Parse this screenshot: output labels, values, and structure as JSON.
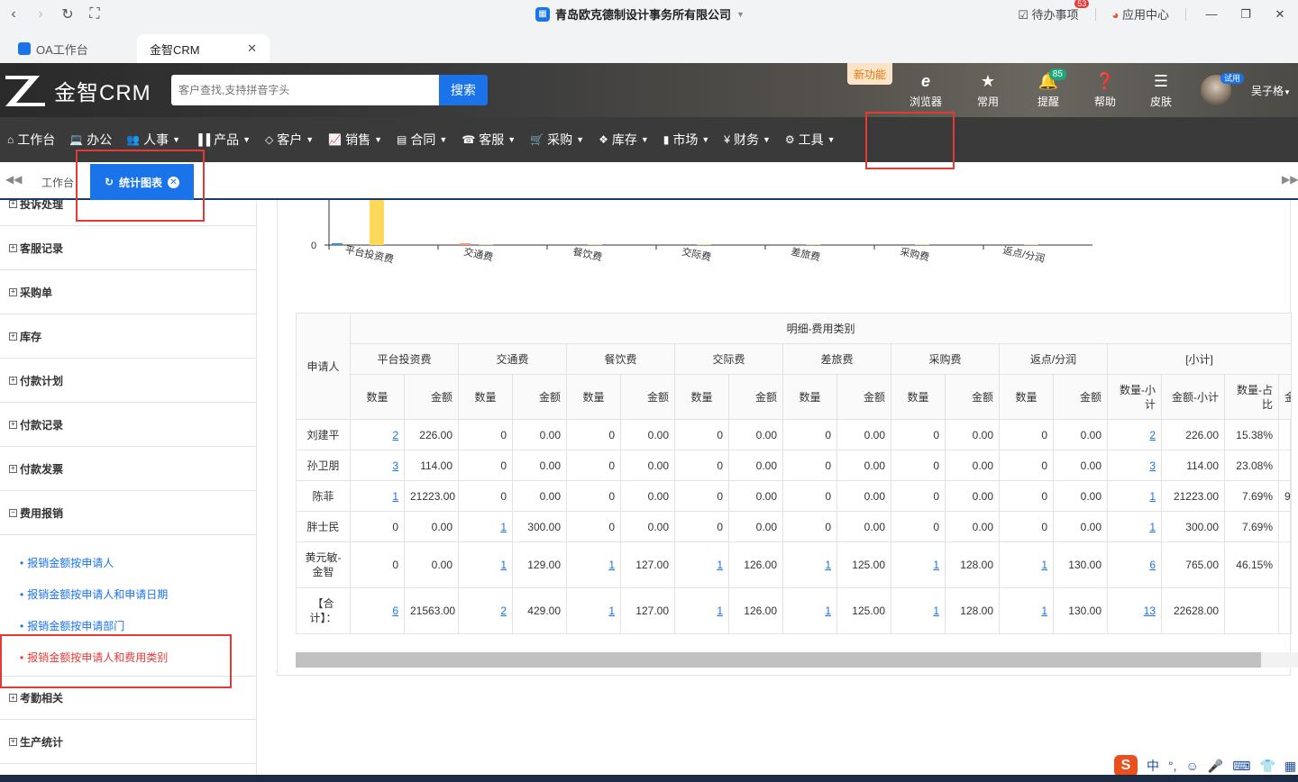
{
  "browser": {
    "title": "青岛欧克德制设计事务所有限公司",
    "todo_label": "待办事项",
    "todo_badge": "53",
    "app_center": "应用中心",
    "tabs": [
      {
        "label": "OA工作台"
      },
      {
        "label": "金智CRM"
      }
    ]
  },
  "header": {
    "logo_text": "金智CRM",
    "search_placeholder": "客户查找,支持拼音字头",
    "search_button": "搜索",
    "new_feature": "新功能",
    "items": [
      {
        "label": "浏览器",
        "icon": "ie-icon"
      },
      {
        "label": "常用",
        "icon": "star-icon"
      },
      {
        "label": "提醒",
        "icon": "bell-icon",
        "badge": "85"
      },
      {
        "label": "帮助",
        "icon": "help-icon"
      },
      {
        "label": "皮肤",
        "icon": "skin-icon"
      }
    ],
    "user_badge": "试用",
    "user_name": "吴子格"
  },
  "menu": [
    {
      "label": "工作台",
      "icon": "home-icon"
    },
    {
      "label": "办公",
      "icon": "laptop-icon"
    },
    {
      "label": "人事",
      "icon": "users-icon"
    },
    {
      "label": "产品",
      "icon": "barcode-icon"
    },
    {
      "label": "客户",
      "icon": "diamond-icon"
    },
    {
      "label": "销售",
      "icon": "chart-icon"
    },
    {
      "label": "合同",
      "icon": "contract-icon"
    },
    {
      "label": "客服",
      "icon": "phone-icon"
    },
    {
      "label": "采购",
      "icon": "cart-icon"
    },
    {
      "label": "库存",
      "icon": "cubes-icon"
    },
    {
      "label": "市场",
      "icon": "bookmark-icon"
    },
    {
      "label": "财务",
      "icon": "yen-icon"
    },
    {
      "label": "工具",
      "icon": "gear-icon"
    }
  ],
  "page_tabs": {
    "home": "工作台",
    "active": "统计图表"
  },
  "sidebar": {
    "groups": [
      {
        "label": "投诉处理",
        "state": "collapsed"
      },
      {
        "label": "客服记录",
        "state": "collapsed"
      },
      {
        "label": "采购单",
        "state": "collapsed"
      },
      {
        "label": "库存",
        "state": "collapsed"
      },
      {
        "label": "付款计划",
        "state": "collapsed"
      },
      {
        "label": "付款记录",
        "state": "collapsed"
      },
      {
        "label": "付款发票",
        "state": "collapsed"
      },
      {
        "label": "费用报销",
        "state": "expanded"
      },
      {
        "label": "考勤相关",
        "state": "collapsed"
      },
      {
        "label": "生产统计",
        "state": "collapsed"
      }
    ],
    "sub_items": [
      {
        "label": "报销金额按申请人"
      },
      {
        "label": "报销金额按申请人和申请日期"
      },
      {
        "label": "报销金额按申请部门"
      },
      {
        "label": "报销金额按申请人和费用类别",
        "active": true
      }
    ]
  },
  "chart_data": {
    "type": "bar",
    "categories": [
      "平台投资费",
      "交通费",
      "餐饮费",
      "交际费",
      "差旅费",
      "采购费",
      "返点/分润"
    ],
    "y_tick_visible": "0",
    "note_partial": "chart cropped at top; only baseline visible",
    "series": [
      {
        "color": "#3a8fd0",
        "values": [
          1,
          0,
          0,
          0,
          0,
          0,
          0
        ]
      },
      {
        "color": "#f59a7a",
        "values": [
          0,
          1,
          0,
          0,
          0,
          0,
          0
        ]
      },
      {
        "color": "#fdd85a",
        "values": [
          40,
          0.2,
          0.2,
          0.2,
          0.2,
          0.2,
          0.2
        ]
      }
    ]
  },
  "table": {
    "group_header": "明细-费用类别",
    "row_header": "申请人",
    "categories": [
      "平台投资费",
      "交通费",
      "餐饮费",
      "交际费",
      "差旅费",
      "采购费",
      "返点/分润",
      "[小计]"
    ],
    "sub_headers": [
      "数量",
      "金额"
    ],
    "subtotal_headers": [
      "数量-小计",
      "金额-小计",
      "数量-占比",
      "金"
    ],
    "rows": [
      {
        "name": "刘建平",
        "cells": [
          "2",
          "226.00",
          "0",
          "0.00",
          "0",
          "0.00",
          "0",
          "0.00",
          "0",
          "0.00",
          "0",
          "0.00",
          "0",
          "0.00",
          "2",
          "226.00",
          "15.38%",
          ""
        ]
      },
      {
        "name": "孙卫朋",
        "cells": [
          "3",
          "114.00",
          "0",
          "0.00",
          "0",
          "0.00",
          "0",
          "0.00",
          "0",
          "0.00",
          "0",
          "0.00",
          "0",
          "0.00",
          "3",
          "114.00",
          "23.08%",
          ""
        ]
      },
      {
        "name": "陈菲",
        "cells": [
          "1",
          "21223.00",
          "0",
          "0.00",
          "0",
          "0.00",
          "0",
          "0.00",
          "0",
          "0.00",
          "0",
          "0.00",
          "0",
          "0.00",
          "1",
          "21223.00",
          "7.69%",
          "9"
        ]
      },
      {
        "name": "胖士民",
        "cells": [
          "0",
          "0.00",
          "1",
          "300.00",
          "0",
          "0.00",
          "0",
          "0.00",
          "0",
          "0.00",
          "0",
          "0.00",
          "0",
          "0.00",
          "1",
          "300.00",
          "7.69%",
          ""
        ]
      },
      {
        "name": "黄元敏-金智",
        "cells": [
          "0",
          "0.00",
          "1",
          "129.00",
          "1",
          "127.00",
          "1",
          "126.00",
          "1",
          "125.00",
          "1",
          "128.00",
          "1",
          "130.00",
          "6",
          "765.00",
          "46.15%",
          ""
        ]
      },
      {
        "name": "【合计】：",
        "cells": [
          "6",
          "21563.00",
          "2",
          "429.00",
          "1",
          "127.00",
          "1",
          "126.00",
          "1",
          "125.00",
          "1",
          "128.00",
          "1",
          "130.00",
          "13",
          "22628.00",
          "",
          ""
        ]
      }
    ]
  },
  "ime": {
    "label": "中"
  }
}
